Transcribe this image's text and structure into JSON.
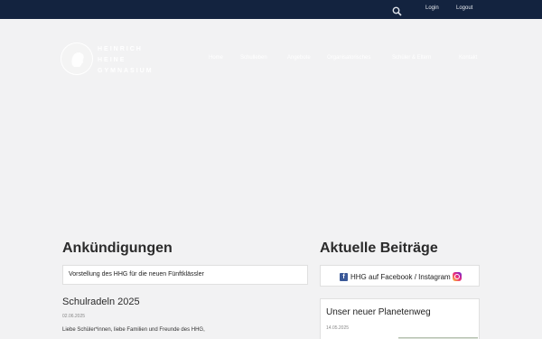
{
  "topbar": {
    "search_icon": "search-icon",
    "login": "Login",
    "logout": "Logout"
  },
  "logo": {
    "line1": "HEINRICH",
    "line2": "HEINE",
    "line3": "GYMNASIUM"
  },
  "nav": {
    "items": [
      "Home",
      "Schulleben",
      "Angebote",
      "Organisatorisches",
      "Schüler & Eltern",
      "Kontakt"
    ]
  },
  "sections": {
    "announcements_title": "Ankündigungen",
    "posts_title": "Aktuelle Beiträge"
  },
  "announcement": {
    "label": "Vorstellung des HHG für die neuen Fünftklässler"
  },
  "social": {
    "label": "HHG auf Facebook / Instagram"
  },
  "post": {
    "title": "Schulradeln 2025",
    "date": "02.06.2025",
    "text": "Liebe Schüler*innen, liebe Familien und Freunde des HHG,"
  },
  "planet": {
    "title": "Unser neuer Planetenweg",
    "date": "14.05.2025"
  },
  "colors": {
    "topbar": "#13233f",
    "accent": "#c0392b",
    "facebook": "#3b5998"
  }
}
